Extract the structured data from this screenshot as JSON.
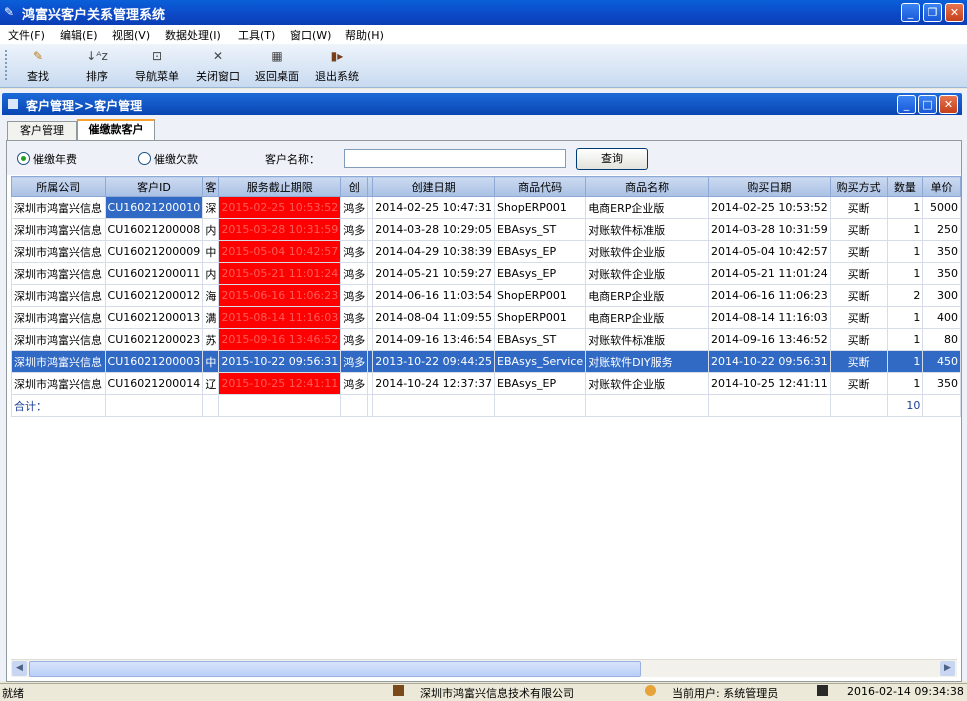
{
  "app": {
    "title": "鸿富兴客户关系管理系统"
  },
  "menu": [
    "文件(F)",
    "编辑(E)",
    "视图(V)",
    "数据处理(I)",
    "工具(T)",
    "窗口(W)",
    "帮助(H)"
  ],
  "toolbar": [
    {
      "label": "查找",
      "icon": "search-icon"
    },
    {
      "label": "排序",
      "icon": "sort-icon"
    },
    {
      "label": "导航菜单",
      "icon": "nav-menu-icon"
    },
    {
      "label": "关闭窗口",
      "icon": "close-icon"
    },
    {
      "label": "返回桌面",
      "icon": "desktop-icon"
    },
    {
      "label": "退出系统",
      "icon": "exit-icon"
    }
  ],
  "child": {
    "title": "客户管理>>客户管理",
    "tabs": [
      "客户管理",
      "催缴款客户"
    ]
  },
  "filters": {
    "radio1": "催缴年费",
    "radio2": "催缴欠款",
    "name_label": "客户名称：",
    "name_value": "",
    "search_label": "查询"
  },
  "grid": {
    "headers": [
      "所属公司",
      "客户ID",
      "客",
      "服务截止期限",
      "创",
      "",
      "创建日期",
      "商品代码",
      "商品名称",
      "购买日期",
      "购买方式",
      "数量",
      "单价"
    ],
    "rows": [
      [
        "深圳市鸿富兴信息",
        "CU16021200010",
        "深",
        "2015-02-25 10:53:52",
        "鸿多",
        "",
        "2014-02-25 10:47:31",
        "ShopERP001",
        "电商ERP企业版",
        "2014-02-25 10:53:52",
        "买断",
        "1",
        "5000"
      ],
      [
        "深圳市鸿富兴信息",
        "CU16021200008",
        "内",
        "2015-03-28 10:31:59",
        "鸿多",
        "",
        "2014-03-28 10:29:05",
        "EBAsys_ST",
        "对账软件标准版",
        "2014-03-28 10:31:59",
        "买断",
        "1",
        "250"
      ],
      [
        "深圳市鸿富兴信息",
        "CU16021200009",
        "中",
        "2015-05-04 10:42:57",
        "鸿多",
        "",
        "2014-04-29 10:38:39",
        "EBAsys_EP",
        "对账软件企业版",
        "2014-05-04 10:42:57",
        "买断",
        "1",
        "350"
      ],
      [
        "深圳市鸿富兴信息",
        "CU16021200011",
        "内",
        "2015-05-21 11:01:24",
        "鸿多",
        "",
        "2014-05-21 10:59:27",
        "EBAsys_EP",
        "对账软件企业版",
        "2014-05-21 11:01:24",
        "买断",
        "1",
        "350"
      ],
      [
        "深圳市鸿富兴信息",
        "CU16021200012",
        "海",
        "2015-06-16 11:06:23",
        "鸿多",
        "",
        "2014-06-16 11:03:54",
        "ShopERP001",
        "电商ERP企业版",
        "2014-06-16 11:06:23",
        "买断",
        "2",
        "300"
      ],
      [
        "深圳市鸿富兴信息",
        "CU16021200013",
        "满",
        "2015-08-14 11:16:03",
        "鸿多",
        "",
        "2014-08-04 11:09:55",
        "ShopERP001",
        "电商ERP企业版",
        "2014-08-14 11:16:03",
        "买断",
        "1",
        "400"
      ],
      [
        "深圳市鸿富兴信息",
        "CU16021200023",
        "苏",
        "2015-09-16 13:46:52",
        "鸿多",
        "",
        "2014-09-16 13:46:54",
        "EBAsys_ST",
        "对账软件标准版",
        "2014-09-16 13:46:52",
        "买断",
        "1",
        "80"
      ],
      [
        "深圳市鸿富兴信息",
        "CU16021200003",
        "中",
        "2015-10-22 09:56:31",
        "鸿多",
        "",
        "2013-10-22 09:44:25",
        "EBAsys_Service",
        "对账软件DIY服务",
        "2014-10-22 09:56:31",
        "买断",
        "1",
        "450"
      ],
      [
        "深圳市鸿富兴信息",
        "CU16021200014",
        "辽",
        "2015-10-25 12:41:11",
        "鸿多",
        "",
        "2014-10-24 12:37:37",
        "EBAsys_EP",
        "对账软件企业版",
        "2014-10-25 12:41:11",
        "买断",
        "1",
        "350"
      ]
    ],
    "selected_row": 7,
    "total_label": "合计：",
    "total_qty": "10"
  },
  "status": {
    "ready": "就绪",
    "company": "深圳市鸿富兴信息技术有限公司",
    "user": "当前用户: 系统管理员",
    "datetime": "2016-02-14 09:34:38"
  },
  "colors": {
    "title_blue": "#0c48c6",
    "alert_red": "#ff0000",
    "selected": "#316ac5"
  }
}
